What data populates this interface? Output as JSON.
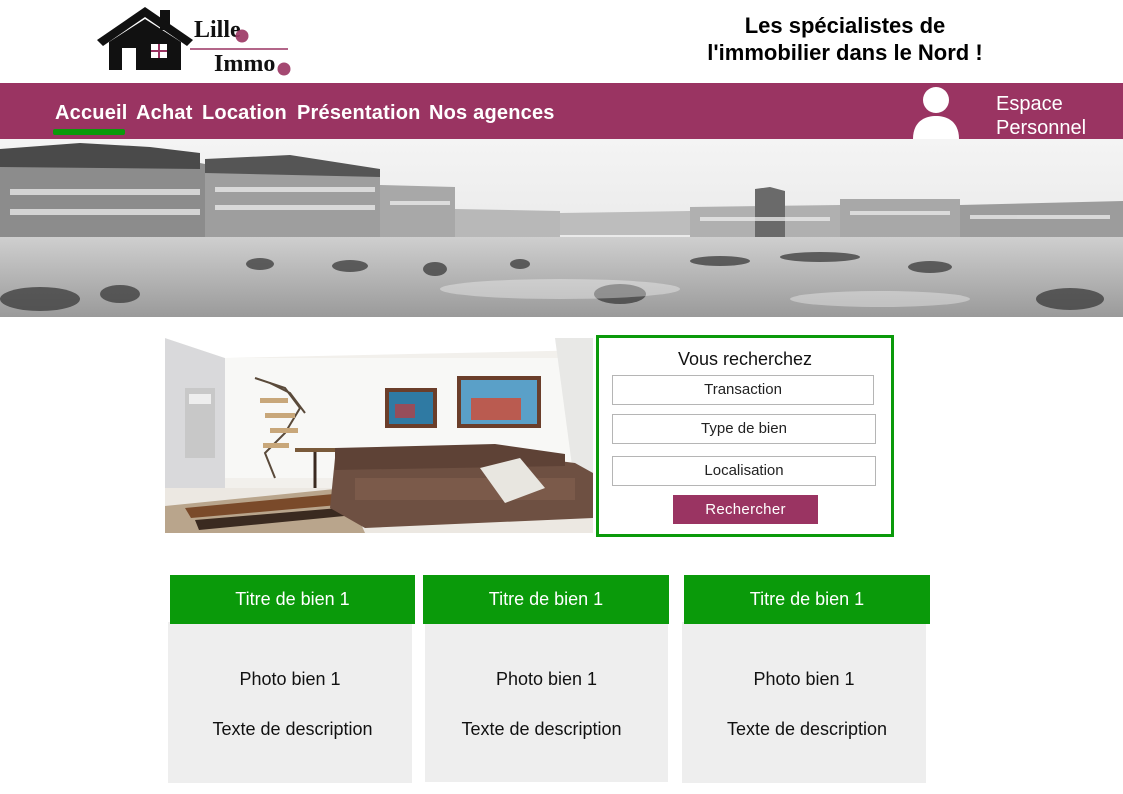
{
  "brand": {
    "logo_line1": "Lille",
    "logo_line2": "Immo",
    "tagline_line1": "Les spécialistes de",
    "tagline_line2": "l'immobilier dans le Nord !",
    "color_primary": "#9a3462",
    "color_accent": "#0a9a0a"
  },
  "nav": {
    "items": [
      {
        "label": "Accueil",
        "active": true
      },
      {
        "label": "Achat"
      },
      {
        "label": "Location"
      },
      {
        "label": "Présentation"
      },
      {
        "label": "Nos agences"
      }
    ],
    "account_line1": "Espace",
    "account_line2": "Personnel",
    "account_icon": "user-icon"
  },
  "search": {
    "title": "Vous recherchez",
    "fields": [
      "Transaction",
      "Type de bien",
      "Localisation"
    ],
    "button": "Rechercher"
  },
  "cards": [
    {
      "title": "Titre de bien 1",
      "photo": "Photo bien 1",
      "description": "Texte de description"
    },
    {
      "title": "Titre de bien 1",
      "photo": "Photo bien 1",
      "description": "Texte de description"
    },
    {
      "title": "Titre de bien 1",
      "photo": "Photo bien 1",
      "description": "Texte de description"
    }
  ]
}
